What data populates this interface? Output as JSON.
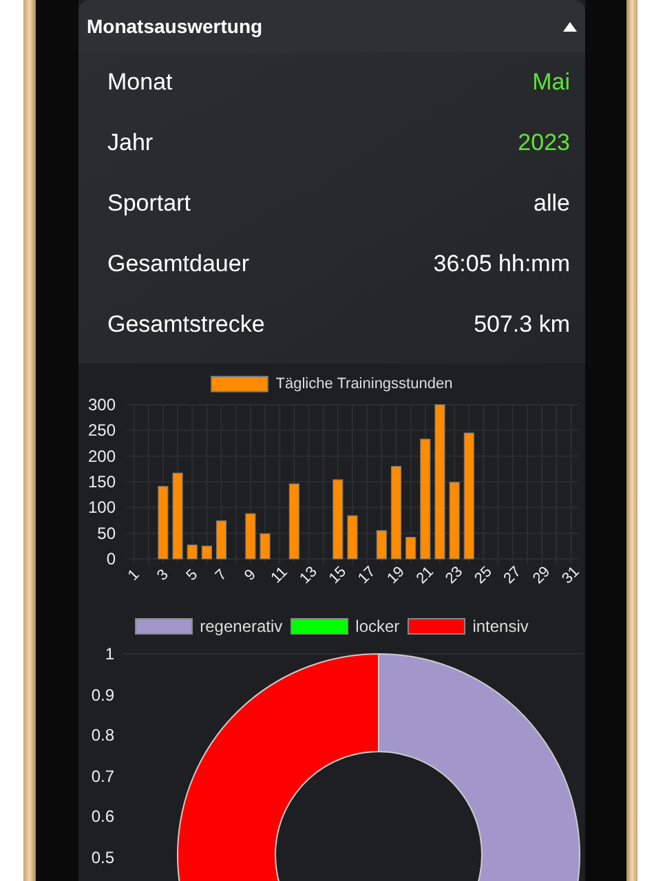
{
  "panel": {
    "title": "Monatsauswertung",
    "expanded": true
  },
  "rows": [
    {
      "label": "Monat",
      "value": "Mai",
      "kind": "picker"
    },
    {
      "label": "Jahr",
      "value": "2023",
      "kind": "picker"
    },
    {
      "label": "Sportart",
      "value": "alle",
      "kind": "text"
    },
    {
      "label": "Gesamtdauer",
      "value": "36:05 hh:mm",
      "kind": "text"
    },
    {
      "label": "Gesamtstrecke",
      "value": "507.3 km",
      "kind": "text"
    }
  ],
  "daily_chart": {
    "chart_data": {
      "type": "bar",
      "x": [
        1,
        2,
        3,
        4,
        5,
        6,
        7,
        8,
        9,
        10,
        11,
        12,
        13,
        14,
        15,
        16,
        17,
        18,
        19,
        20,
        21,
        22,
        23,
        24,
        25,
        26,
        27,
        28,
        29,
        30,
        31
      ],
      "xlim": [
        0.5,
        31.5
      ],
      "grid": true,
      "series": [
        {
          "name": "Tägliche Trainingsstunden",
          "color": "#ff8c00",
          "values": [
            0,
            0,
            141,
            167,
            27,
            25,
            74,
            0,
            88,
            49,
            0,
            146,
            0,
            0,
            154,
            84,
            0,
            55,
            180,
            42,
            233,
            300,
            149,
            245,
            0,
            0,
            0,
            0,
            0,
            0,
            0
          ]
        }
      ],
      "ylim": [
        0,
        300
      ],
      "yticks": [
        0,
        50,
        100,
        150,
        200,
        250,
        300
      ],
      "xticks": [
        1,
        3,
        5,
        7,
        9,
        11,
        13,
        15,
        17,
        19,
        21,
        23,
        25,
        27,
        29,
        31
      ]
    }
  },
  "intensity_chart": {
    "legend": [
      {
        "label": "regenerativ",
        "color": "#a197cb"
      },
      {
        "label": "locker",
        "color": "#00ff00"
      },
      {
        "label": "intensiv",
        "color": "#ff0000"
      }
    ],
    "axis_labels": [
      "1",
      "0.9",
      "0.8",
      "0.7",
      "0.6",
      "0.5"
    ]
  }
}
